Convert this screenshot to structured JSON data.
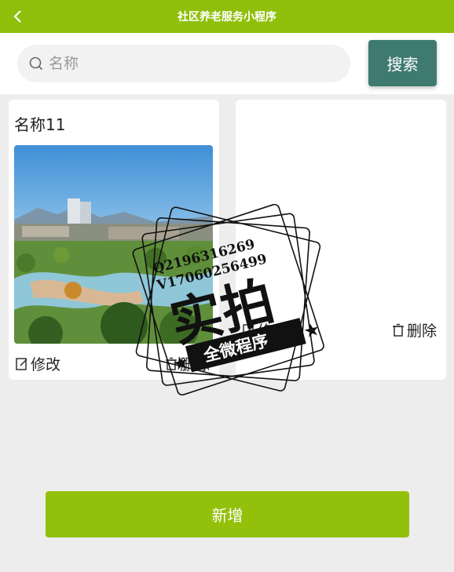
{
  "header": {
    "title": "社区养老服务小程序",
    "back_icon": "chevron-left-icon"
  },
  "search": {
    "placeholder": "名称",
    "value": "",
    "button_label": "搜索",
    "icon": "search-icon"
  },
  "cards": [
    {
      "name": "名称11",
      "edit_label": "修改",
      "delete_label": "删除"
    },
    {
      "name": "",
      "edit_label": "修改",
      "delete_label": "删除"
    }
  ],
  "watermark": {
    "line1": "Q2196316269",
    "line2": "V17060256499",
    "main": "实拍",
    "banner": "全微程序"
  },
  "footer": {
    "add_label": "新增"
  },
  "colors": {
    "accent": "#8fbf0a",
    "search_button": "#3f7a70",
    "background": "#ededed"
  }
}
